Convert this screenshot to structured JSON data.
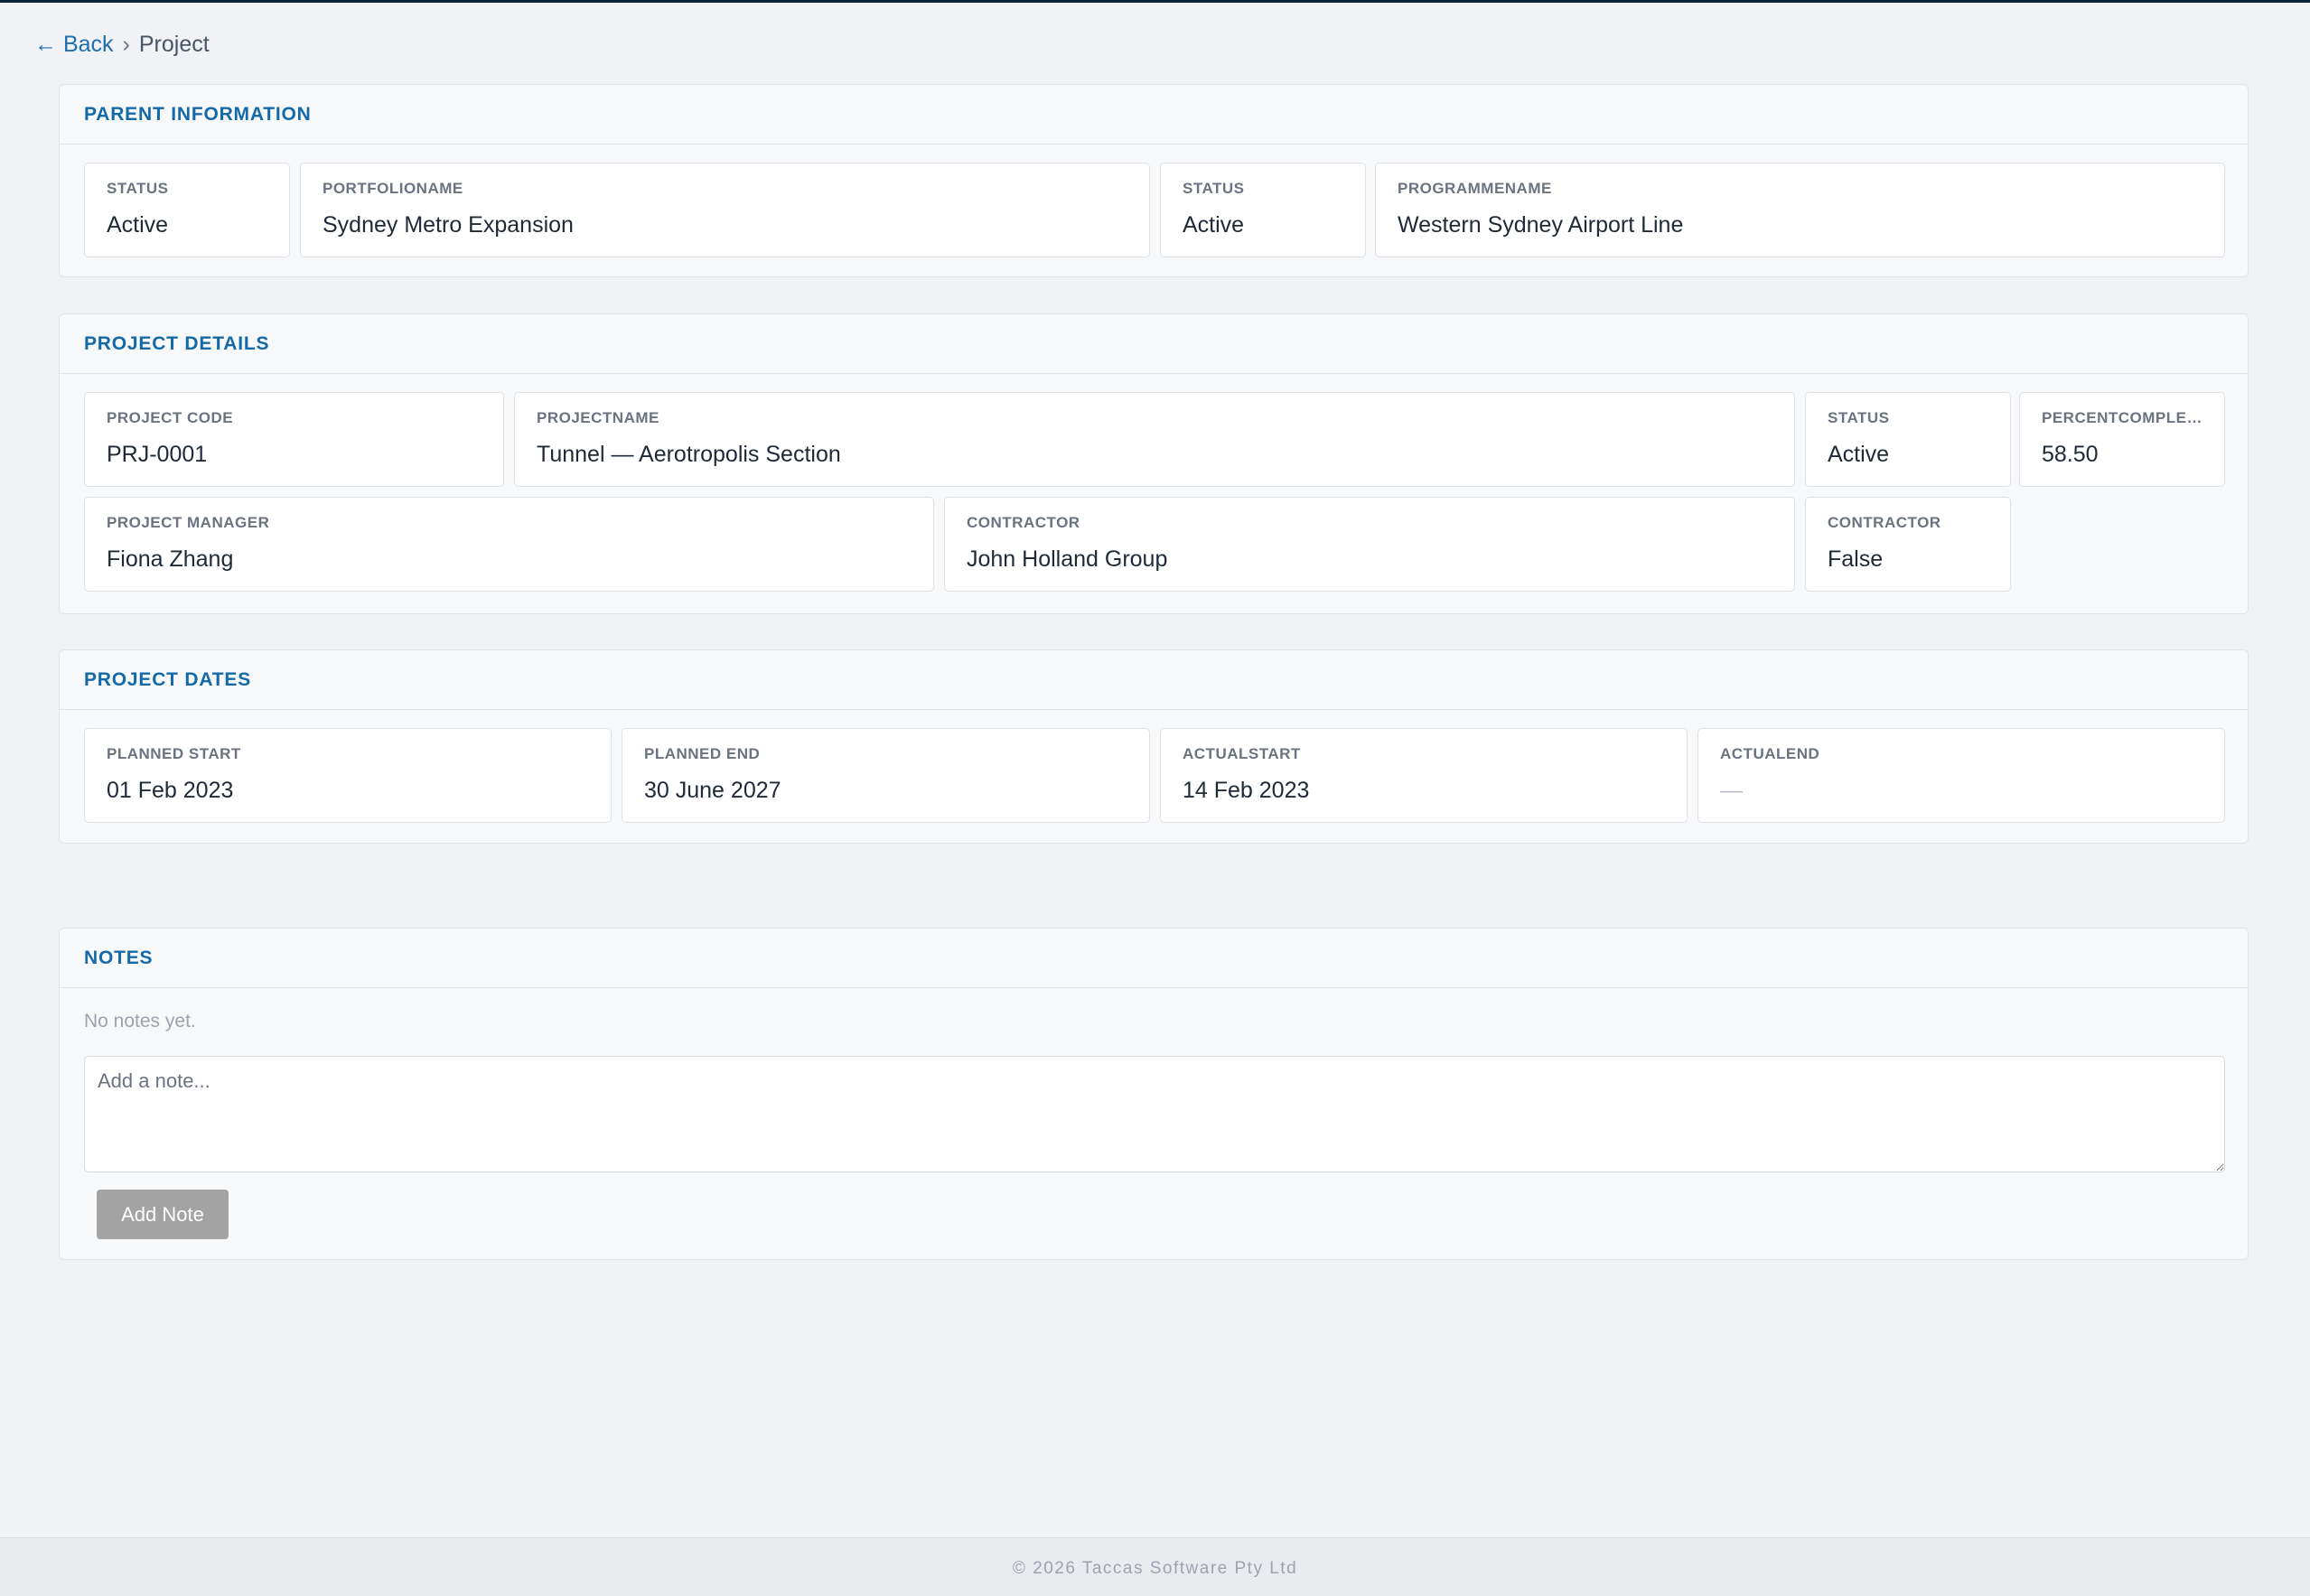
{
  "breadcrumb": {
    "back_label": "← Back",
    "separator": "›",
    "current": "Project"
  },
  "parent_info": {
    "title": "PARENT INFORMATION",
    "fields": [
      {
        "label": "STATUS",
        "value": "Active"
      },
      {
        "label": "PORTFOLIONAME",
        "value": "Sydney Metro Expansion"
      },
      {
        "label": "STATUS",
        "value": "Active"
      },
      {
        "label": "PROGRAMMENAME",
        "value": "Western Sydney Airport Line"
      }
    ]
  },
  "project_details": {
    "title": "PROJECT DETAILS",
    "fields": [
      {
        "label": "PROJECT CODE",
        "value": "PRJ-0001"
      },
      {
        "label": "PROJECTNAME",
        "value": "Tunnel — Aerotropolis Section"
      },
      {
        "label": "STATUS",
        "value": "Active"
      },
      {
        "label": "PERCENTCOMPLETE",
        "value": "58.50"
      },
      {
        "label": "PROJECT MANAGER",
        "value": "Fiona Zhang"
      },
      {
        "label": "CONTRACTOR",
        "value": "John Holland Group"
      },
      {
        "label": "CONTRACTOR",
        "value": "False"
      }
    ]
  },
  "project_dates": {
    "title": "PROJECT DATES",
    "fields": [
      {
        "label": "PLANNED START",
        "value": "01 Feb 2023"
      },
      {
        "label": "PLANNED END",
        "value": "30 June 2027"
      },
      {
        "label": "ACTUALSTART",
        "value": "14 Feb 2023"
      },
      {
        "label": "ACTUALEND",
        "value": "—"
      }
    ]
  },
  "notes": {
    "title": "NOTES",
    "empty_text": "No notes yet.",
    "input_placeholder": "Add a note...",
    "input_value": "",
    "add_button_label": "Add Note"
  },
  "footer": {
    "text": "© 2026 Taccas Software Pty Ltd"
  }
}
